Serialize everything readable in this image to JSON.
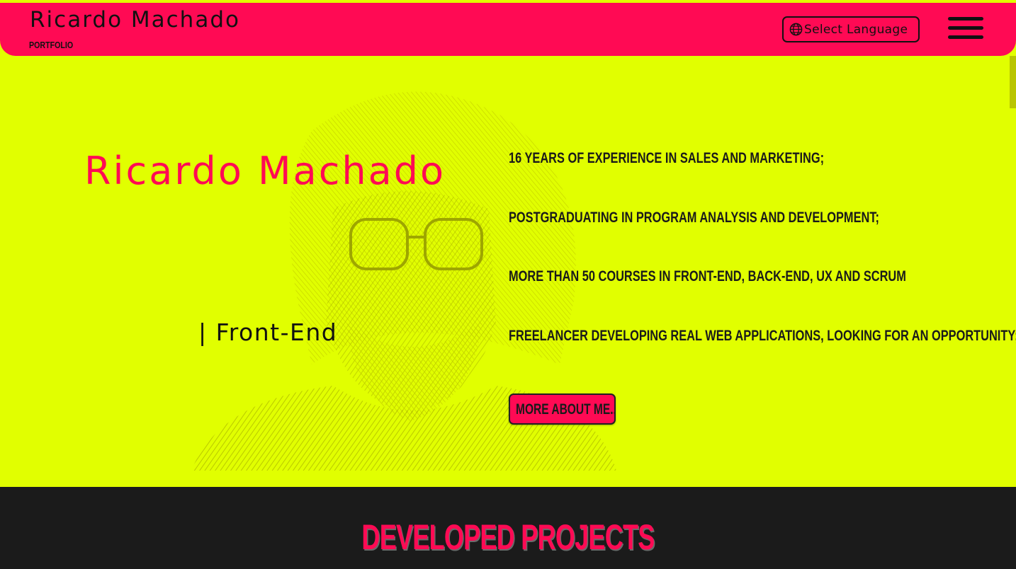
{
  "header": {
    "brand_name": "Ricardo Machado",
    "brand_sub": "PORTFOLIO",
    "language_button": "Select Language",
    "globe_icon": "globe-icon",
    "menu_icon": "hamburger-menu-icon"
  },
  "hero": {
    "name": "Ricardo Machado",
    "role": "| Front-End",
    "bullets": [
      "16 years of experience in sales and marketing;",
      "Postgraduating in Program Analysis and Development;",
      "More than 50 courses in Front-end, Back-end, UX and Scrum",
      "Freelancer developing real web applications, looking for an opportunity;"
    ],
    "about_button": "More about me..."
  },
  "projects": {
    "title": "Developed projects"
  },
  "colors": {
    "accent": "#ff0a54",
    "hero_background": "#e1ff00",
    "dark_background": "#1b1b1b"
  }
}
